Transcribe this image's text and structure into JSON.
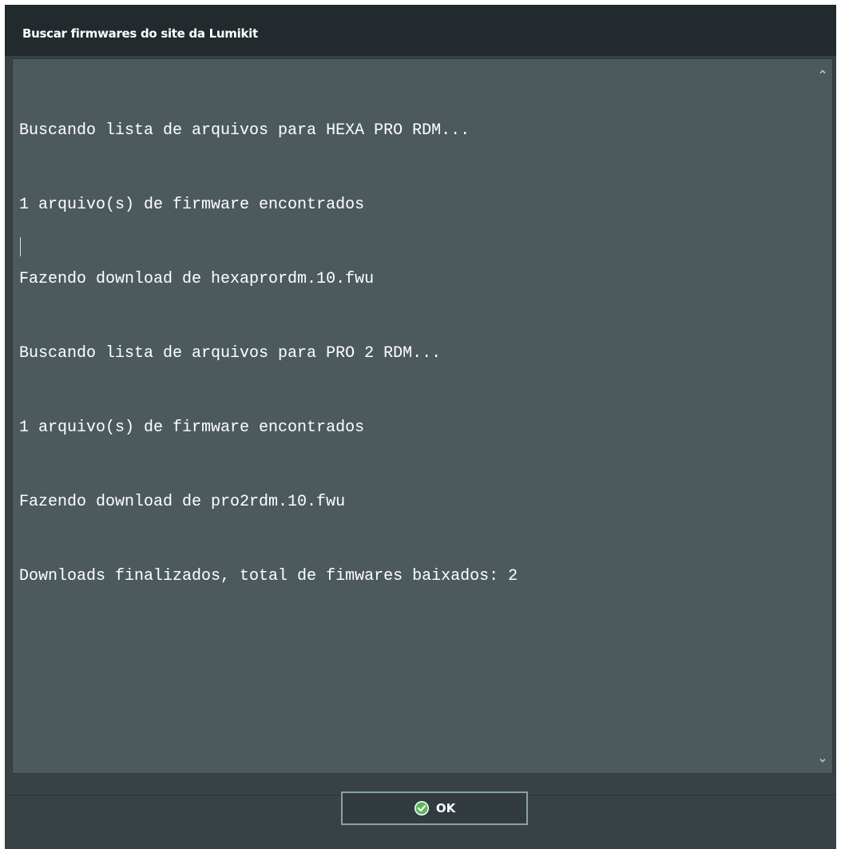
{
  "window": {
    "title": "Buscar firmwares do site da Lumikit"
  },
  "log": {
    "lines": [
      "Buscando lista de arquivos para HEXA PRO RDM...",
      "1 arquivo(s) de firmware encontrados",
      "Fazendo download de hexaprordm.10.fwu",
      "Buscando lista de arquivos para PRO 2 RDM...",
      "1 arquivo(s) de firmware encontrados",
      "Fazendo download de pro2rdm.10.fwu",
      "Downloads finalizados, total de fimwares baixados: 2"
    ]
  },
  "scrollbar": {
    "up_icon": "chevron-up-icon",
    "down_icon": "chevron-down-icon"
  },
  "footer": {
    "ok_label": "OK",
    "ok_icon": "check-circle-icon"
  },
  "colors": {
    "titlebar": "#232a2d",
    "window": "#384246",
    "log_background": "#4c5a5e",
    "button_border": "#87a3a2",
    "check_green": "#5cb85c"
  }
}
